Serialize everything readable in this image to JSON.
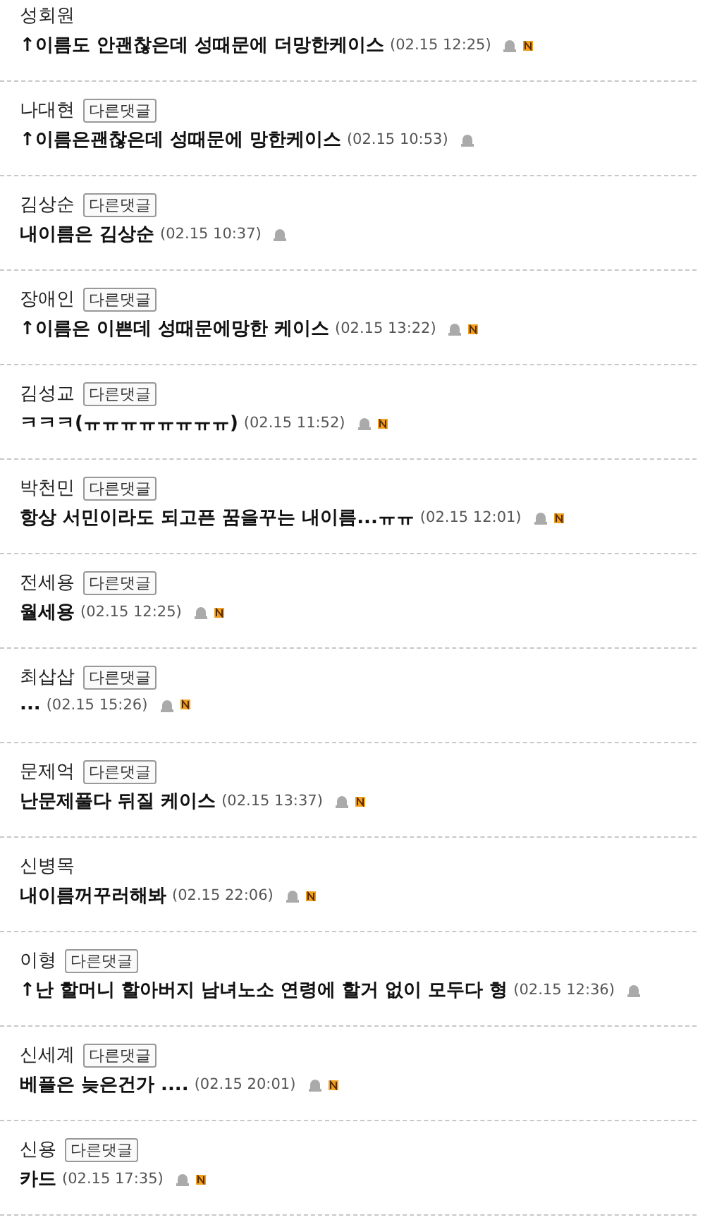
{
  "comments": [
    {
      "author": "성회원",
      "text": "↑이름도 안괜찮은데 성때문에 더망한케이스",
      "time": "(02.15 12:25)",
      "new": true
    },
    {
      "author": "나대현",
      "other_link": "다른댓글",
      "text": "↑이름은괜찮은데 성때문에 망한케이스",
      "time": "(02.15 10:53)",
      "new": false
    },
    {
      "author": "김상순",
      "other_link": "다른댓글",
      "text": "내이름은 김상순",
      "time": "(02.15 10:37)",
      "new": false
    },
    {
      "author": "장애인",
      "other_link": "다른댓글",
      "text": "↑이름은 이쁜데 성때문에망한 케이스",
      "time": "(02.15 13:22)",
      "new": true
    },
    {
      "author": "김성교",
      "other_link": "다른댓글",
      "text": "ㅋㅋㅋ(ㅠㅠㅠㅠㅠㅠㅠㅠ)",
      "time": "(02.15 11:52)",
      "new": true
    },
    {
      "author": "박천민",
      "other_link": "다른댓글",
      "text": "항상 서민이라도 되고픈 꿈을꾸는 내이름...ㅠㅠ",
      "time": "(02.15 12:01)",
      "new": true
    },
    {
      "author": "전세용",
      "other_link": "다른댓글",
      "text": "월세용",
      "time": "(02.15 12:25)",
      "new": true
    },
    {
      "author": "최삽삽",
      "other_link": "다른댓글",
      "text": "...",
      "time": "(02.15 15:26)",
      "new": true
    },
    {
      "author": "문제억",
      "other_link": "다른댓글",
      "text": "난문제풀다 뒤질 케이스",
      "time": "(02.15 13:37)",
      "new": true
    },
    {
      "author": "신병목",
      "text": "내이름꺼꾸러해봐",
      "time": "(02.15 22:06)",
      "new": true
    },
    {
      "author": "이형",
      "other_link": "다른댓글",
      "text": "↑난 할머니 할아버지 남녀노소 연령에 할거 없이 모두다 형",
      "time": "(02.15 12:36)",
      "new": false
    },
    {
      "author": "신세계",
      "other_link": "다른댓글",
      "text": "베플은 늦은건가 ....",
      "time": "(02.15 20:01)",
      "new": true
    },
    {
      "author": "신용",
      "other_link": "다른댓글",
      "text": "카드",
      "time": "(02.15 17:35)",
      "new": true
    }
  ]
}
